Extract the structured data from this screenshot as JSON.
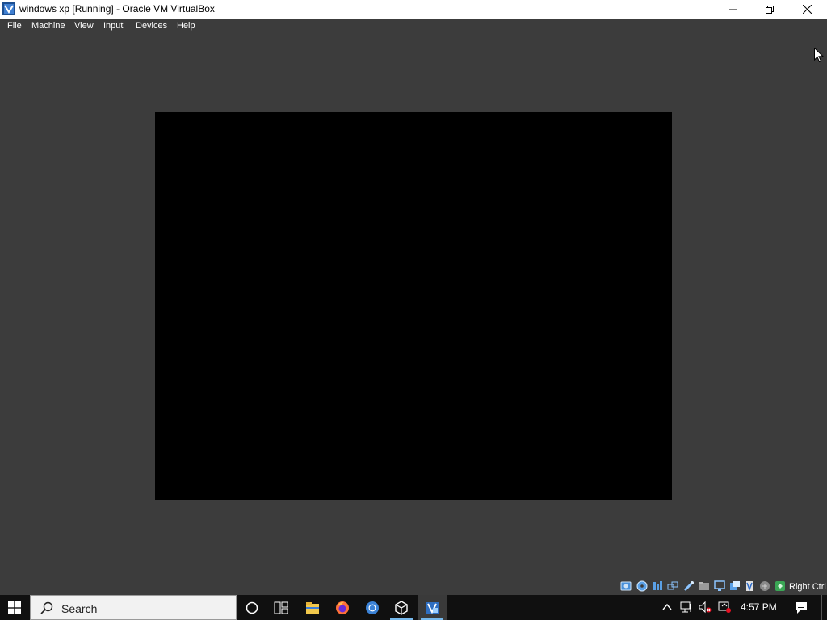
{
  "window": {
    "title": "windows xp [Running] - Oracle VM VirtualBox"
  },
  "menu": {
    "items": [
      "File",
      "Machine",
      "View",
      "Input",
      "Devices",
      "Help"
    ]
  },
  "statusbar": {
    "host_key": "Right Ctrl",
    "icons": [
      "hard-disk-icon",
      "optical-drive-icon",
      "audio-icon",
      "network-icon",
      "usb-icon",
      "shared-folders-icon",
      "display-icon",
      "recording-icon",
      "cpu-icon",
      "mouse-integration-icon",
      "keyboard-icon"
    ]
  },
  "taskbar": {
    "search_label": "Search",
    "apps": [
      "cortana-icon",
      "task-view-icon",
      "file-explorer-icon",
      "firefox-icon",
      "chrome-icon",
      "virtualbox-manager-icon",
      "virtualbox-vm-icon"
    ],
    "clock": "4:57 PM"
  },
  "colors": {
    "window_bg": "#3c3c3c",
    "vm_screen": "#000000",
    "taskbar_bg": "#101010",
    "accent": "#76b9ed"
  }
}
